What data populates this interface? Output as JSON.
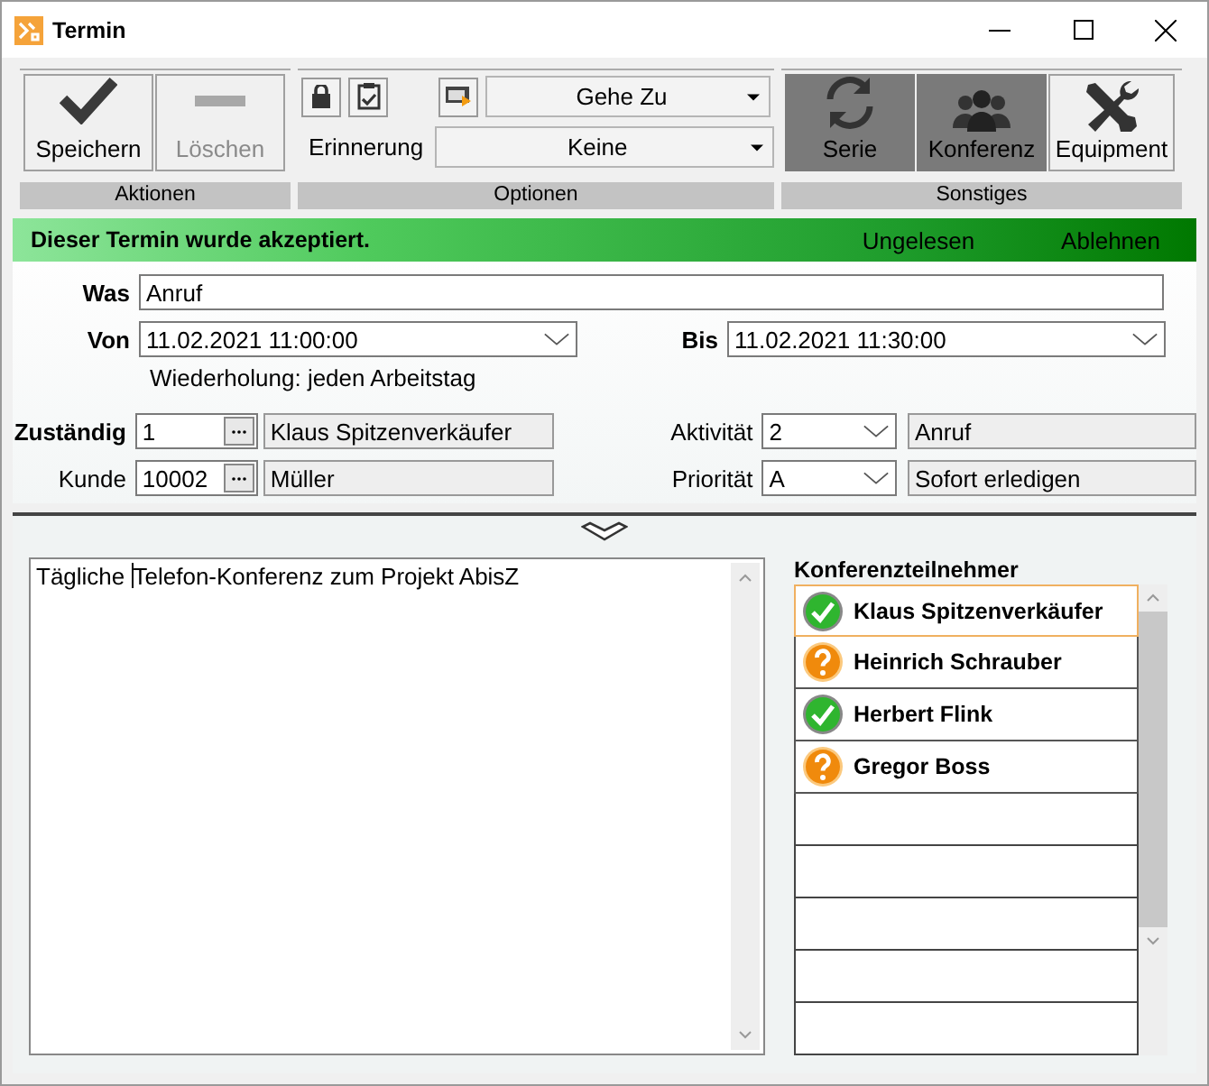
{
  "window": {
    "title": "Termin"
  },
  "ribbon": {
    "groups": [
      {
        "kind": "actions",
        "label": "Aktionen",
        "buttons": [
          {
            "label": "Speichern",
            "disabled": false
          },
          {
            "label": "Löschen",
            "disabled": true
          }
        ]
      },
      {
        "kind": "options",
        "label": "Optionen",
        "goto": "Gehe Zu",
        "reminder_label": "Erinnerung",
        "reminder": "Keine"
      },
      {
        "kind": "toggles",
        "label": "Sonstiges",
        "buttons": [
          {
            "label": "Serie",
            "on": true
          },
          {
            "label": "Konferenz",
            "on": true
          },
          {
            "label": "Equipment",
            "on": false
          }
        ]
      }
    ]
  },
  "status_banner": {
    "message": "Dieser Termin wurde akzeptiert.",
    "links": [
      "Ungelesen",
      "Ablehnen"
    ]
  },
  "form": {
    "was": {
      "label": "Was",
      "value": "Anruf",
      "required": true
    },
    "von": {
      "label": "Von",
      "value": "11.02.2021 11:00:00",
      "required": true
    },
    "bis": {
      "label": "Bis",
      "value": "11.02.2021 11:30:00",
      "required": true
    },
    "recurrence": "Wiederholung: jeden Arbeitstag",
    "lookups": [
      {
        "label": "Zuständig",
        "required": true,
        "code": "1",
        "name": "Klaus Spitzenverkäufer"
      },
      {
        "label": "Kunde",
        "required": false,
        "code": "10002",
        "name": "Müller"
      }
    ],
    "selects": [
      {
        "label": "Aktivität",
        "code": "2",
        "description": "Anruf"
      },
      {
        "label": "Priorität",
        "code": "A",
        "description": "Sofort erledigen"
      }
    ]
  },
  "notes": {
    "before_cursor": "Tägliche ",
    "after_cursor": "Telefon-Konferenz zum Projekt AbisZ"
  },
  "participants": {
    "title": "Konferenzteilnehmer",
    "items": [
      {
        "name": "Klaus Spitzenverkäufer",
        "kind": "accepted",
        "selected": true
      },
      {
        "name": "Heinrich Schrauber",
        "kind": "pending",
        "selected": false
      },
      {
        "name": "Herbert Flink",
        "kind": "accepted",
        "selected": false
      },
      {
        "name": "Gregor Boss",
        "kind": "pending",
        "selected": false
      }
    ]
  }
}
